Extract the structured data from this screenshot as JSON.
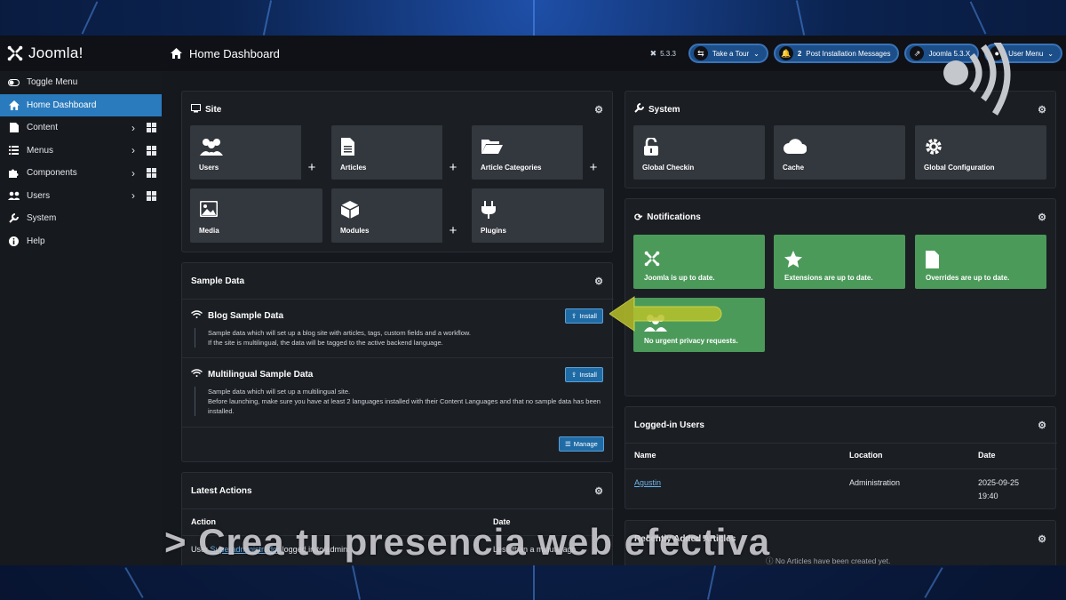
{
  "header": {
    "logo_text": "Joomla!",
    "page_title": "Home Dashboard",
    "version": "5.3.3",
    "take_tour": "Take a Tour",
    "post_count": "2",
    "post_install": "Post Installation Messages",
    "joomla_link": "Joomla 5.3.X",
    "user_menu": "User Menu"
  },
  "sidebar": {
    "items": [
      {
        "label": "Toggle Menu",
        "icon": "toggle-icon"
      },
      {
        "label": "Home Dashboard",
        "icon": "home-icon"
      },
      {
        "label": "Content",
        "icon": "file-icon"
      },
      {
        "label": "Menus",
        "icon": "list-icon"
      },
      {
        "label": "Components",
        "icon": "puzzle-icon"
      },
      {
        "label": "Users",
        "icon": "users-icon"
      },
      {
        "label": "System",
        "icon": "wrench-icon"
      },
      {
        "label": "Help",
        "icon": "info-icon"
      }
    ]
  },
  "site": {
    "title": "Site",
    "tiles": [
      "Users",
      "Articles",
      "Article Categories",
      "Media",
      "Modules",
      "Plugins"
    ]
  },
  "system": {
    "title": "System",
    "tiles": [
      "Global Checkin",
      "Cache",
      "Global Configuration"
    ]
  },
  "notifications": {
    "title": "Notifications",
    "tiles": [
      "Joomla is up to date.",
      "Extensions are up to date.",
      "Overrides are up to date.",
      "No urgent privacy requests."
    ]
  },
  "sample_data": {
    "title": "Sample Data",
    "blog_title": "Blog Sample Data",
    "blog_desc_1": "Sample data which will set up a blog site with articles, tags, custom fields and a workflow.",
    "blog_desc_2": "If the site is multilingual, the data will be tagged to the active backend language.",
    "multi_title": "Multilingual Sample Data",
    "multi_desc_1": "Sample data which will set up a multilingual site.",
    "multi_desc_2": "Before launching, make sure you have at least 2 languages installed with their Content Languages and that no sample data has been installed.",
    "install": "Install",
    "manage": "Manage"
  },
  "logged_in": {
    "title": "Logged-in Users",
    "col_name": "Name",
    "col_location": "Location",
    "col_date": "Date",
    "row_name": "Agustin",
    "row_location": "Administration",
    "row_date_1": "2025-09-25",
    "row_date_2": "19:40"
  },
  "recent_articles": {
    "title": "Recently Added Articles",
    "empty": "No Articles have been created yet."
  },
  "latest_actions": {
    "title": "Latest Actions",
    "col_action": "Action",
    "col_date": "Date",
    "row_prefix": "User ",
    "row_user": "Superadministrador",
    "row_suffix": " logged in to admin.",
    "row_date": "Less than a minute ago."
  },
  "overlay_caption": "> Crea tu presencia web efectiva",
  "colors": {
    "accent": "#2a7bbd",
    "notification_green": "#4b9a5a",
    "tile_grey": "#33373e",
    "annotation_yellow": "#b9c22a"
  }
}
